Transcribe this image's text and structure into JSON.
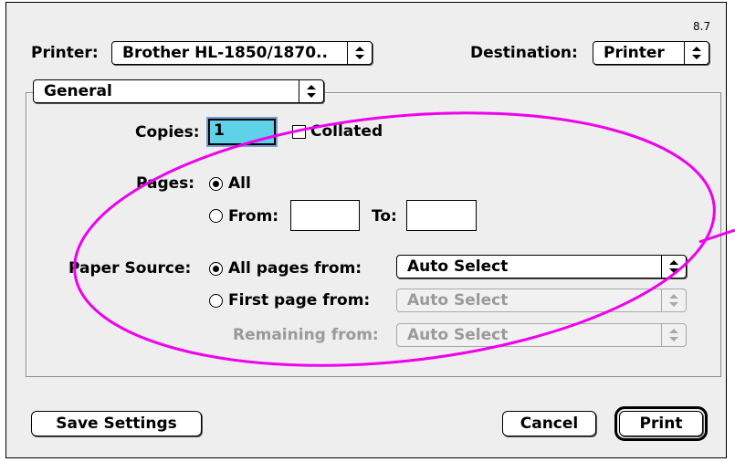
{
  "window": {
    "version": "8.7"
  },
  "printer": {
    "label": "Printer:",
    "value": "Brother HL-1850/1870.."
  },
  "destination": {
    "label": "Destination:",
    "value": "Printer"
  },
  "panel_menu": {
    "value": "General"
  },
  "copies": {
    "label": "Copies:",
    "value": "1",
    "collated_label": "Collated"
  },
  "pages": {
    "label": "Pages:",
    "all_label": "All",
    "from_label": "From:",
    "to_label": "To:"
  },
  "paper_source": {
    "label": "Paper Source:",
    "all_pages_from_label": "All pages from:",
    "all_pages_from_value": "Auto Select",
    "first_page_from_label": "First page from:",
    "first_page_from_value": "Auto Select",
    "remaining_from_label": "Remaining from:",
    "remaining_from_value": "Auto Select"
  },
  "buttons": {
    "save_settings": "Save Settings",
    "cancel": "Cancel",
    "print": "Print"
  },
  "colors": {
    "annotation": "#ee00ee",
    "copies_highlight": "#5fd1e8"
  },
  "icons": {
    "popup_arrow": "up-down-arrows-icon",
    "radio": "radio-button-icon",
    "checkbox": "checkbox-icon"
  }
}
